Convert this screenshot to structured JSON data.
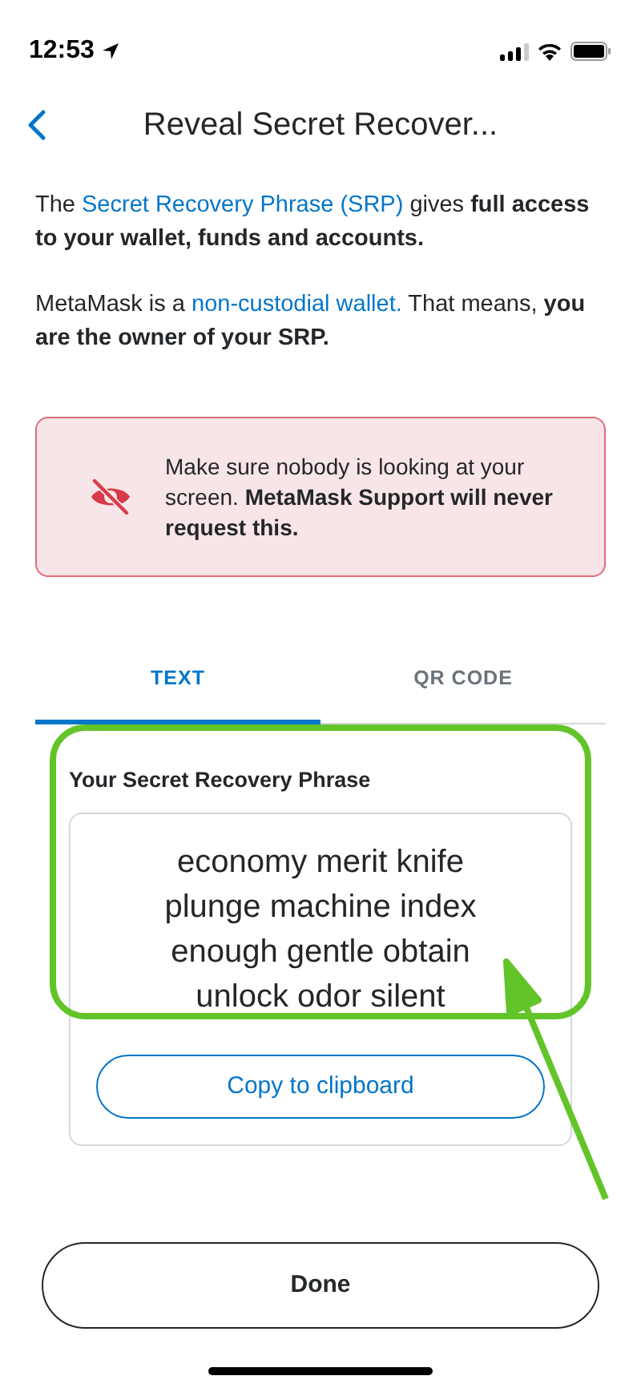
{
  "status_bar": {
    "time": "12:53"
  },
  "header": {
    "title": "Reveal Secret Recover..."
  },
  "paragraphs": [
    {
      "parts": [
        {
          "kind": "text",
          "text": "The "
        },
        {
          "kind": "link",
          "text": "Secret Recovery Phrase (SRP)"
        },
        {
          "kind": "text",
          "text": " gives **full access to your wallet, funds and accounts.**"
        }
      ]
    },
    {
      "parts": [
        {
          "kind": "text",
          "text": "MetaMask is a "
        },
        {
          "kind": "link",
          "text": "non-custodial wallet."
        },
        {
          "kind": "text",
          "text": " That means, **you are the owner of your SRP.**"
        }
      ]
    }
  ],
  "warning": {
    "text": "Make sure nobody is looking at your screen. **MetaMask Support will never request this.**"
  },
  "tabs": [
    {
      "label": "TEXT",
      "selected": true
    },
    {
      "label": "QR CODE",
      "selected": false
    }
  ],
  "phrase_card": {
    "label": "Your Secret Recovery Phrase",
    "phrase": "economy merit knife plunge machine index enough gentle obtain unlock odor silent",
    "copy_button": "Copy to clipboard"
  },
  "done_button": "Done"
}
